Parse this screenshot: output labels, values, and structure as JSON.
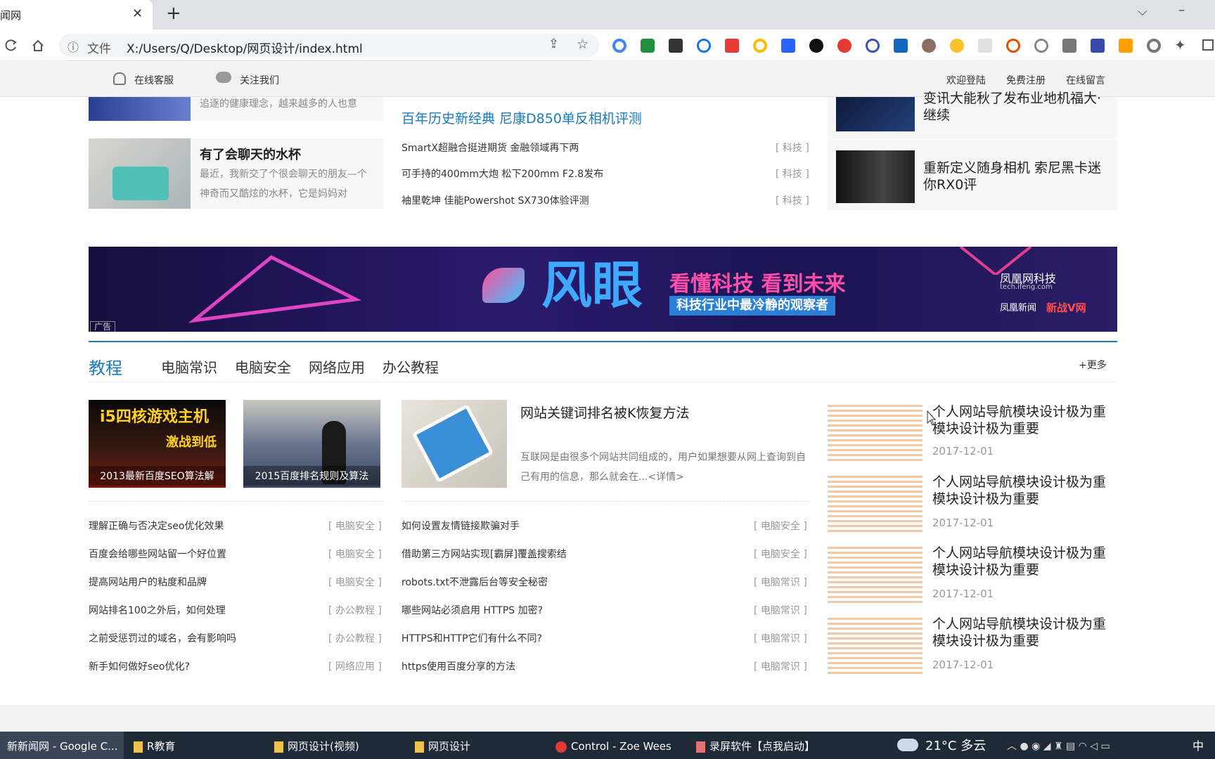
{
  "browser": {
    "tab_title": "闻网",
    "tab_close": "✕",
    "new_tab": "+",
    "file_label": "文件",
    "url": "X:/Users/Q/Desktop/网页设计/index.html",
    "min_glyph": "–",
    "menu_glyph": "⌵"
  },
  "site_header": {
    "left": [
      "在线客服",
      "关注我们"
    ],
    "right": [
      "欢迎登陆",
      "免费注册",
      "在线留言"
    ]
  },
  "top_section": {
    "left_cards": [
      {
        "title": "",
        "desc": "追逐的健康理念，越来越多的人也意"
      },
      {
        "title": "有了会聊天的水杯",
        "desc": "最近，我新交了个很会聊天的朋友—个神奇而又酷炫的水杯，它是妈妈对"
      }
    ],
    "headline": "百年历史新经典 尼康D850单反相机评测",
    "news": [
      {
        "text": "SmartX超融合挺进期货 金融领域再下两",
        "tag": "[ 科技 ]"
      },
      {
        "text": "可手持的400mm大炮 松下200mm F2.8发布",
        "tag": "[ 科技 ]"
      },
      {
        "text": "袖里乾坤 佳能Powershot SX730体验评测",
        "tag": "[ 科技 ]"
      }
    ],
    "right_items": [
      {
        "text": "变讯大能秋了发布业地机福大·继续"
      },
      {
        "text": "重新定义随身相机 索尼黑卡迷你RX0评"
      }
    ]
  },
  "banner": {
    "brand": "风眼",
    "slogan": "看懂科技 看到未来",
    "sub": "科技行业中最冷静的观察者",
    "corner": "凤凰网科技",
    "corner2": "tech.ifeng.com",
    "corner3": "凤凰新闻",
    "corner4": "新战V网",
    "ad": "广告"
  },
  "tutorial": {
    "title": "教程",
    "tabs": [
      "电脑常识",
      "电脑安全",
      "网络应用",
      "办公教程"
    ],
    "more": "+更多",
    "thumb1_caption": "2013最新百度SEO算法解",
    "thumb1_banner": "i5四核游戏主机",
    "thumb1_sub": "激战到低",
    "thumb2_caption": "2015百度排名规则及算法",
    "feature_title": "网站关键词排名被K恢复方法",
    "feature_desc": "互联网是由很多个网站共同组成的，用户如果想要从网上查询到自己有用的信息，那么就会在...",
    "feature_more": "<详情>",
    "left_list": [
      {
        "text": "理解正确与否决定seo优化效果",
        "tag": "[ 电脑安全 ]"
      },
      {
        "text": "百度会给哪些网站留一个好位置",
        "tag": "[ 电脑安全 ]"
      },
      {
        "text": "提高网站用户的粘度和品牌",
        "tag": "[ 电脑安全 ]"
      },
      {
        "text": "网站排名100之外后，如何处理",
        "tag": "[ 办公教程 ]"
      },
      {
        "text": "之前受惩罚过的域名，会有影响吗",
        "tag": "[ 办公教程 ]"
      },
      {
        "text": "新手如何做好seo优化?",
        "tag": "[ 网络应用 ]"
      }
    ],
    "mid_list": [
      {
        "text": "如何设置友情链接欺骗对手",
        "tag": "[ 电脑安全 ]"
      },
      {
        "text": "借助第三方网站实现[霸屏]覆盖搜索结",
        "tag": "[ 电脑安全 ]"
      },
      {
        "text": "robots.txt不泄露后台等安全秘密",
        "tag": "[ 电脑常识 ]"
      },
      {
        "text": "哪些网站必须启用 HTTPS 加密?",
        "tag": "[ 电脑常识 ]"
      },
      {
        "text": "HTTPS和HTTP它们有什么不同?",
        "tag": "[ 电脑常识 ]"
      },
      {
        "text": "https使用百度分享的方法",
        "tag": "[ 电脑常识 ]"
      }
    ],
    "right_list": [
      {
        "text": "个人网站导航模块设计极为重模块设计极为重要",
        "date": "2017-12-01"
      },
      {
        "text": "个人网站导航模块设计极为重模块设计极为重要",
        "date": "2017-12-01"
      },
      {
        "text": "个人网站导航模块设计极为重模块设计极为重要",
        "date": "2017-12-01"
      },
      {
        "text": "个人网站导航模块设计极为重模块设计极为重要",
        "date": "2017-12-01"
      }
    ]
  },
  "taskbar": {
    "items": [
      "新新闻网 - Google C...",
      "R教育",
      "网页设计(视频)",
      "网页设计",
      "Control - Zoe Wees",
      "录屏软件【点我启动】"
    ],
    "weather": "21°C 多云",
    "ime": "中"
  },
  "colors": {
    "accent": "#1a7bbd",
    "taskbar": "#1f2a38",
    "banner": "#1b1550"
  }
}
